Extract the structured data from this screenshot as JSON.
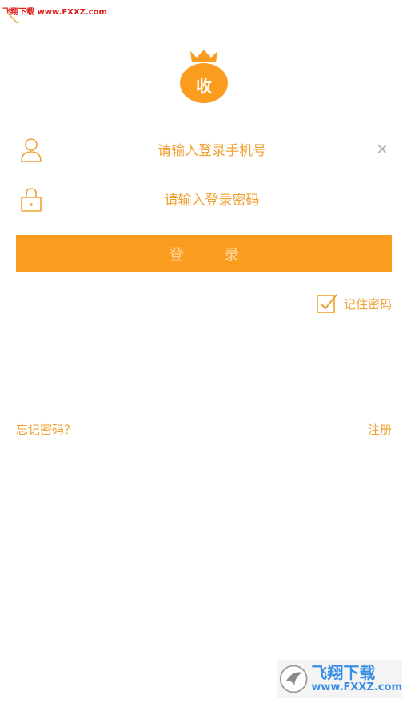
{
  "watermark": {
    "text": "飞翔下载 www.FXXZ.com"
  },
  "logo": {
    "character": "收"
  },
  "form": {
    "phone": {
      "placeholder": "请输入登录手机号",
      "value": ""
    },
    "password": {
      "placeholder": "请输入登录密码",
      "value": ""
    },
    "login_label": "登 录",
    "remember_label": "记住密码",
    "remember_checked": true
  },
  "links": {
    "forgot": "忘记密码？",
    "register": "注册"
  },
  "brand_watermark": {
    "name": "飞翔下载",
    "url": "www.FXXZ.com"
  },
  "colors": {
    "accent": "#fa9c1e",
    "accent_text": "#f0a030",
    "clear_icon": "#b0b0b0"
  }
}
